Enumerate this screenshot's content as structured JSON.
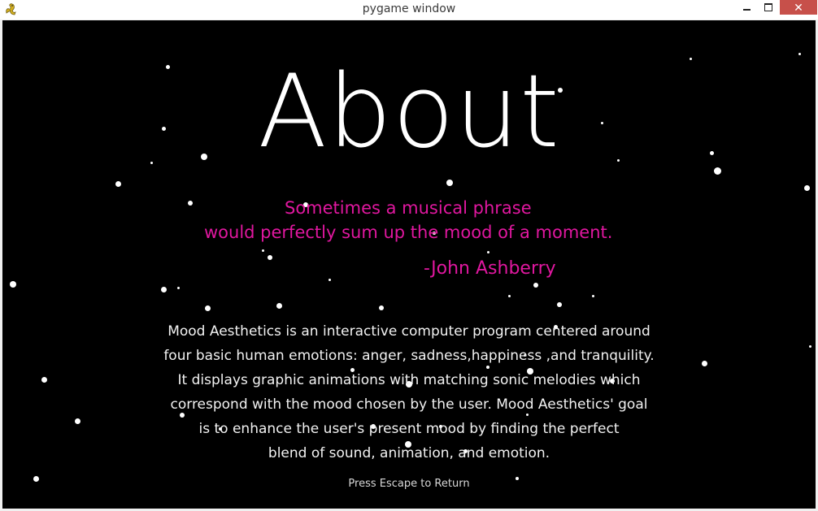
{
  "window": {
    "title": "pygame window",
    "minimize_glyph": "",
    "maximize_glyph": "",
    "close_glyph": "✕"
  },
  "content": {
    "heading": "About",
    "quote": {
      "line1": "Sometimes a musical phrase",
      "line2": "would perfectly sum up the mood of a moment.",
      "author": "-John Ashberry"
    },
    "description_lines": [
      "Mood Aesthetics is an interactive computer program centered around",
      "four basic human emotions: anger, sadness,happiness ,and tranquility.",
      "It displays graphic animations with matching sonic melodies which",
      "correspond with the mood chosen by the user. Mood Aesthetics' goal",
      "is to enhance the user's present mood by finding the perfect",
      "blend of sound, animation, and emotion."
    ],
    "hint": "Press Escape to Return"
  },
  "colors": {
    "background": "#000000",
    "heading": "#ffffff",
    "quote": "#e0179f",
    "body_text": "#f2f2f2",
    "close_button": "#c7504a"
  },
  "icons": {
    "app": "pygame-snake-icon",
    "minimize": "minimize-icon",
    "maximize": "maximize-icon",
    "close": "close-icon"
  }
}
